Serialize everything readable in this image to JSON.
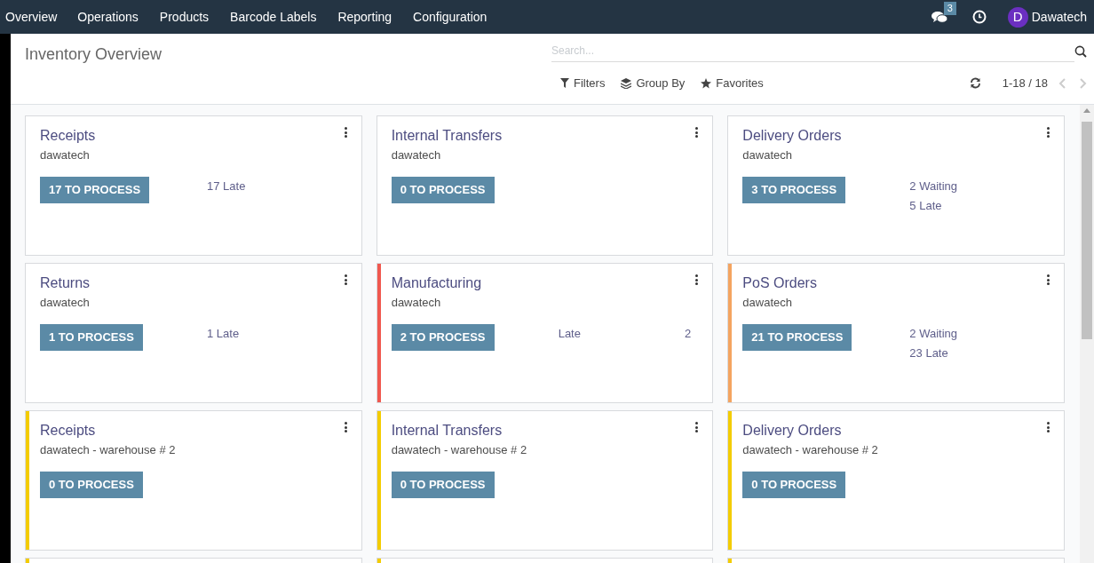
{
  "nav": {
    "menu": [
      "Overview",
      "Operations",
      "Products",
      "Barcode Labels",
      "Reporting",
      "Configuration"
    ],
    "messages_count": "3",
    "user_initial": "D",
    "user_name": "Dawatech"
  },
  "control_panel": {
    "title": "Inventory Overview",
    "search": {
      "placeholder": "Search..."
    },
    "filters": [
      {
        "kind": "filter",
        "label": "Filters"
      },
      {
        "kind": "group",
        "label": "Group By"
      },
      {
        "kind": "star",
        "label": "Favorites"
      }
    ],
    "pager": "1-18 / 18"
  },
  "cards": [
    {
      "title": "Receipts",
      "subtitle": "dawatech",
      "button": "17 TO PROCESS",
      "stats": [
        {
          "kind": "line",
          "text": "17 Late"
        }
      ]
    },
    {
      "title": "Internal Transfers",
      "subtitle": "dawatech",
      "button": "0 TO PROCESS"
    },
    {
      "title": "Delivery Orders",
      "subtitle": "dawatech",
      "button": "3 TO PROCESS",
      "stats": [
        {
          "kind": "line",
          "text": "2 Waiting"
        },
        {
          "kind": "line",
          "text": "5 Late"
        }
      ]
    },
    {
      "title": "Returns",
      "subtitle": "dawatech",
      "button": "1 TO PROCESS",
      "stats": [
        {
          "kind": "line",
          "text": "1 Late"
        }
      ]
    },
    {
      "title": "Manufacturing",
      "subtitle": "dawatech",
      "color": "#f0584f",
      "button": "2 TO PROCESS",
      "stats": [
        {
          "kind": "pair",
          "label": "Late",
          "value": "2"
        }
      ]
    },
    {
      "title": "PoS Orders",
      "subtitle": "dawatech",
      "color": "#f4a460",
      "button": "21 TO PROCESS",
      "stats": [
        {
          "kind": "line",
          "text": "2 Waiting"
        },
        {
          "kind": "line",
          "text": "23 Late"
        }
      ]
    },
    {
      "title": "Receipts",
      "subtitle": "dawatech - warehouse # 2",
      "color": "#f3cc00",
      "button": "0 TO PROCESS"
    },
    {
      "title": "Internal Transfers",
      "subtitle": "dawatech - warehouse # 2",
      "color": "#f3cc00",
      "button": "0 TO PROCESS"
    },
    {
      "title": "Delivery Orders",
      "subtitle": "dawatech - warehouse # 2",
      "color": "#f3cc00",
      "button": "0 TO PROCESS"
    }
  ],
  "cut_off_cards": [
    {
      "color": "#f3cc00"
    },
    {
      "color": "#f3cc00"
    },
    {
      "color": "#f3cc00"
    }
  ]
}
